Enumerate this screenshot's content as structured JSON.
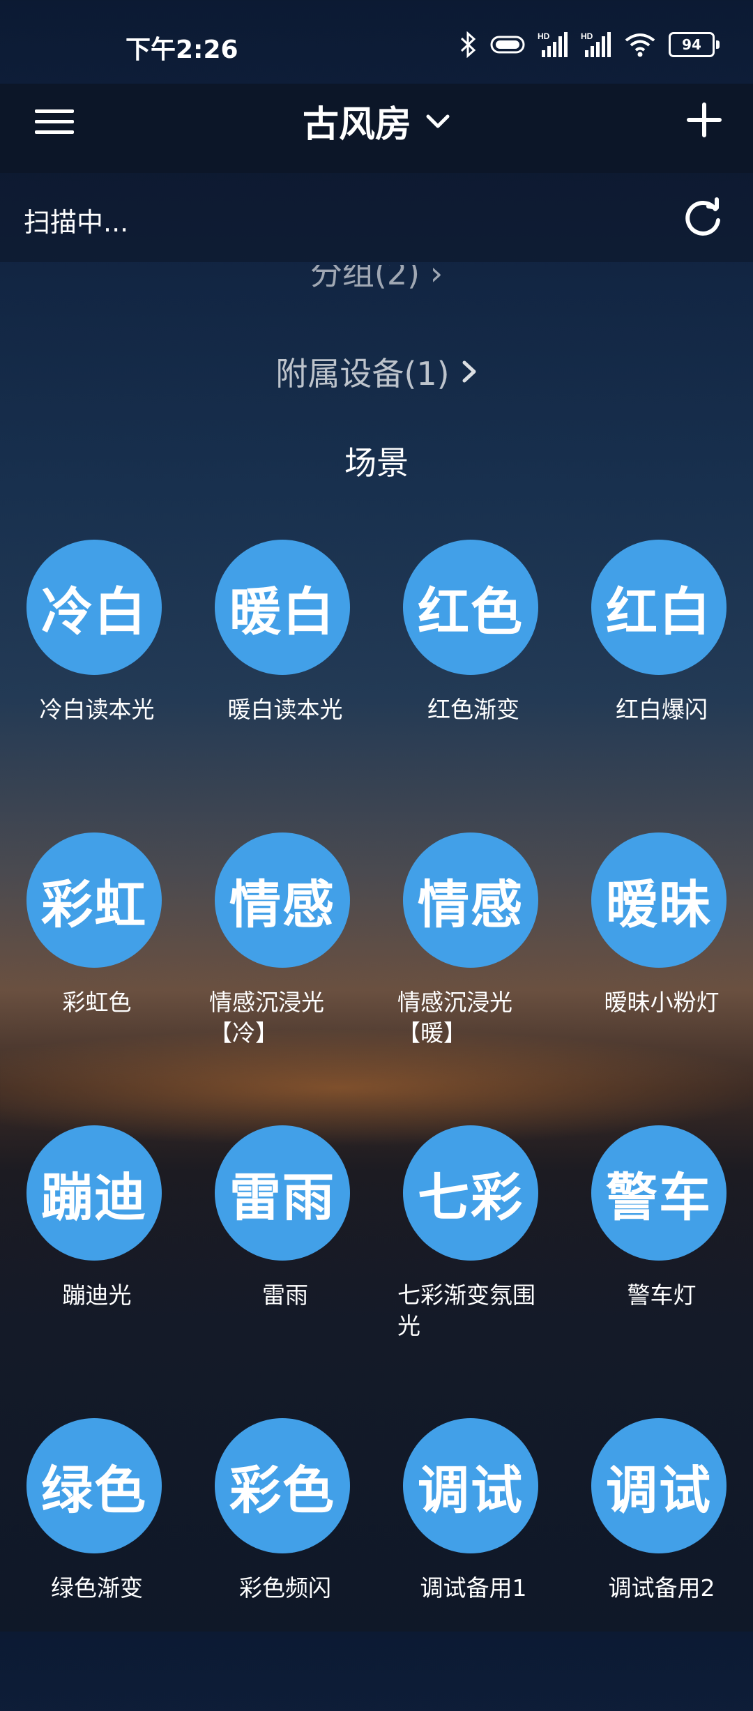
{
  "status_bar": {
    "time": "下午2:26",
    "battery": "94",
    "icons": [
      "bluetooth-icon",
      "vpn-icon",
      "signal-hd-icon",
      "signal-hd-icon",
      "wifi-icon",
      "battery-icon"
    ]
  },
  "header": {
    "title": "古风房"
  },
  "scan": {
    "text": "扫描中..."
  },
  "sections": {
    "groups": "分组(2)",
    "attached": "附属设备(1)",
    "scenes_title": "场景"
  },
  "colors": {
    "scene_circle": "#42a0e8",
    "header_bg": "#0c1628"
  },
  "scenes": [
    {
      "short": "冷白",
      "label": "冷白读本光"
    },
    {
      "short": "暖白",
      "label": "暖白读本光"
    },
    {
      "short": "红色",
      "label": "红色渐变"
    },
    {
      "short": "红白",
      "label": "红白爆闪"
    },
    {
      "short": "彩虹",
      "label": "彩虹色"
    },
    {
      "short": "情感",
      "label": "情感沉浸光【冷】"
    },
    {
      "short": "情感",
      "label": "情感沉浸光【暖】"
    },
    {
      "short": "暧昧",
      "label": "暧昧小粉灯"
    },
    {
      "short": "蹦迪",
      "label": "蹦迪光"
    },
    {
      "short": "雷雨",
      "label": "雷雨"
    },
    {
      "short": "七彩",
      "label": "七彩渐变氛围光"
    },
    {
      "short": "警车",
      "label": "警车灯"
    },
    {
      "short": "绿色",
      "label": "绿色渐变"
    },
    {
      "short": "彩色",
      "label": "彩色频闪"
    },
    {
      "short": "调试",
      "label": "调试备用1"
    },
    {
      "short": "调试",
      "label": "调试备用2"
    }
  ]
}
